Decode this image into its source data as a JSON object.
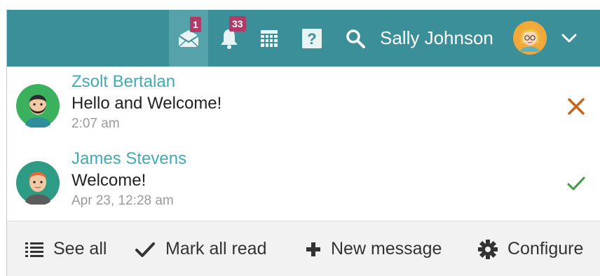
{
  "header": {
    "messages_badge": "1",
    "notifications_badge": "33",
    "user_name": "Sally Johnson",
    "icons": [
      "envelope-icon",
      "bell-icon",
      "calendar-icon",
      "help-icon",
      "search-icon",
      "chevron-down-icon"
    ]
  },
  "messages": [
    {
      "sender": "Zsolt Bertalan",
      "body": "Hello and Welcome!",
      "time": "2:07 am",
      "status": "unread",
      "action_icon": "close-icon"
    },
    {
      "sender": "James Stevens",
      "body": "Welcome!",
      "time": "Apr 23, 12:28 am",
      "status": "read",
      "action_icon": "check-icon"
    }
  ],
  "footer": {
    "see_all": "See all",
    "mark_all_read": "Mark all read",
    "new_message": "New message",
    "configure": "Configure"
  },
  "colors": {
    "topbar": "#3b8f98",
    "topbar_active": "#55a2aa",
    "badge": "#b23a68",
    "sender": "#41aab5",
    "close": "#c8641c",
    "check": "#3f9b3f"
  }
}
